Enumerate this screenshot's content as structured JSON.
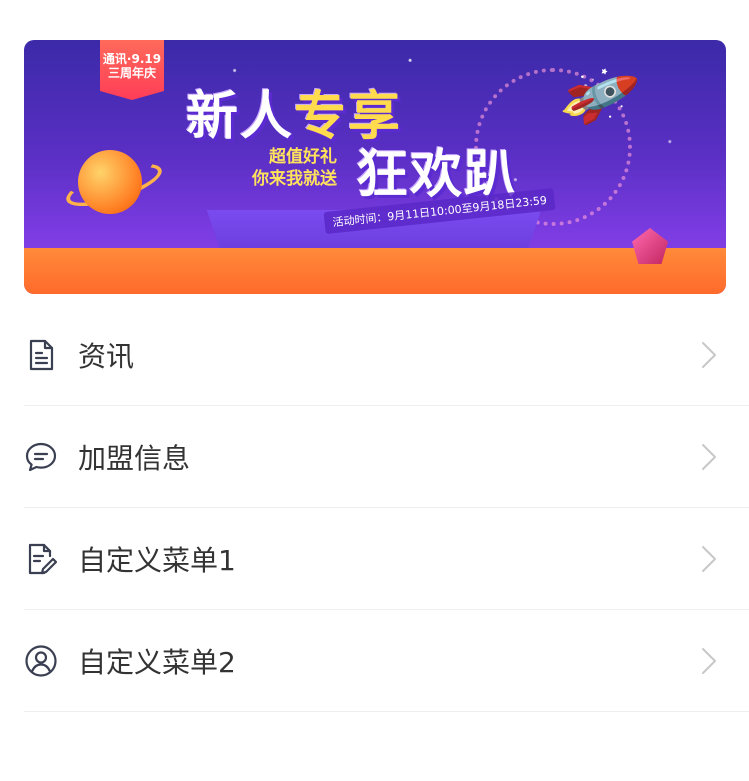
{
  "banner": {
    "ribbon_text": "通讯·9.19\n三周年庆",
    "headline_part1": "新人",
    "headline_part2": "专享",
    "headline_line2": "狂欢趴",
    "subtitle_line1": "超值好礼",
    "subtitle_line2": "你来我就送",
    "activity_time": "活动时间：9月11日10:00至9月18日23:59"
  },
  "menu": {
    "items": [
      {
        "label": "资讯",
        "icon": "document-icon"
      },
      {
        "label": "加盟信息",
        "icon": "chat-bubble-icon"
      },
      {
        "label": "自定义菜单1",
        "icon": "edit-document-icon"
      },
      {
        "label": "自定义菜单2",
        "icon": "user-circle-icon"
      }
    ]
  },
  "colors": {
    "text": "#333333",
    "icon": "#3a3f52",
    "chevron": "#c8c8c8",
    "divider": "#eeeeee",
    "banner_purple": "#5a2fc4",
    "banner_orange": "#ff6a2b"
  }
}
